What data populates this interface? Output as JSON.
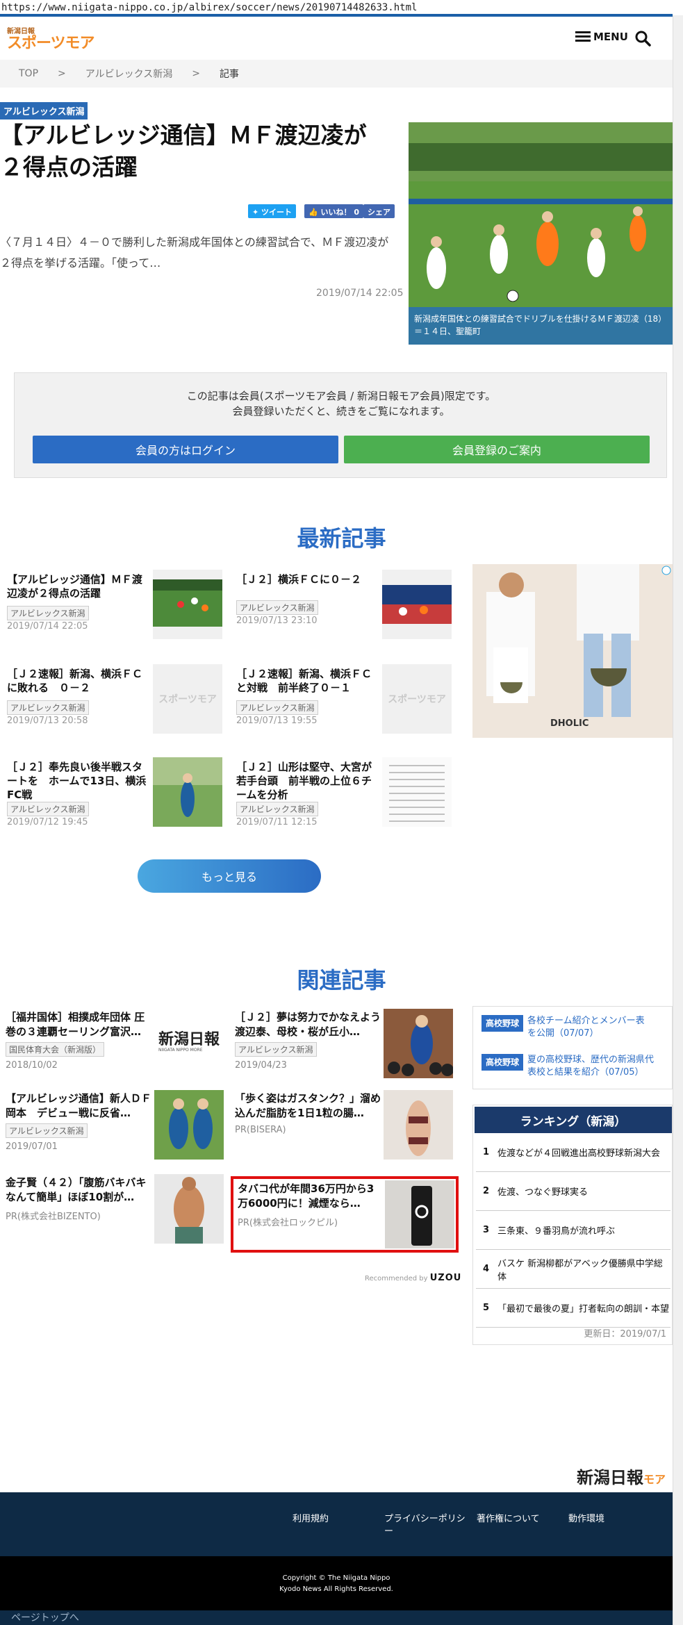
{
  "url": "https://www.niigata-nippo.co.jp/albirex/soccer/news/20190714482633.html",
  "header": {
    "logo_small": "新潟日報",
    "logo_main": "スポーツモア",
    "menu_label": "MENU"
  },
  "breadcrumb": [
    "TOP",
    ">",
    "アルビレックス新潟",
    ">",
    "記事"
  ],
  "article": {
    "category": "アルビレックス新潟",
    "title": "【アルビレッジ通信】ＭＦ渡辺凌が２得点の活躍",
    "share": {
      "tweet": "ツイート",
      "like": "いいね！ 0",
      "share": "シェア"
    },
    "lead": "〈７月１４日〉４－０で勝利した新潟成年国体との練習試合で、ＭＦ渡辺凌が２得点を挙げる活躍。「使って…",
    "date": "2019/07/14 22:05",
    "photo_caption": "新潟成年国体との練習試合でドリブルを仕掛けるＭＦ渡辺凌（18）＝１４日、聖籠町"
  },
  "member": {
    "line1": "この記事は会員(スポーツモア会員 / 新潟日報モア会員)限定です。",
    "line2": "会員登録いただくと、続きをご覧になれます。",
    "login": "会員の方はログイン",
    "register": "会員登録のご案内"
  },
  "latest": {
    "heading": "最新記事",
    "items": [
      {
        "title": "【アルビレッジ通信】ＭＦ渡辺凌が２得点の活躍",
        "tag": "アルビレックス新潟",
        "date": "2019/07/14 22:05"
      },
      {
        "title": "［Ｊ２］横浜ＦＣに０－２",
        "tag": "アルビレックス新潟",
        "date": "2019/07/13 23:10"
      },
      {
        "title": "［Ｊ２速報］新潟、横浜ＦＣに敗れる　０－２",
        "tag": "アルビレックス新潟",
        "date": "2019/07/13 20:58"
      },
      {
        "title": "［Ｊ２速報］新潟、横浜ＦＣと対戦　前半終了０－１",
        "tag": "アルビレックス新潟",
        "date": "2019/07/13 19:55"
      },
      {
        "title": "［Ｊ２］奉先良い後半戦スタートを　ホームで13日、横浜FC戦",
        "tag": "アルビレックス新潟",
        "date": "2019/07/12 19:45"
      },
      {
        "title": "［Ｊ２］山形は堅守、大宮が若手台頭　前半戦の上位６チームを分析",
        "tag": "アルビレックス新潟",
        "date": "2019/07/11 12:15"
      }
    ],
    "thumb_logo_text": "スポーツモア",
    "more": "もっと見る",
    "ad_brand": "DHOLIC"
  },
  "related": {
    "heading": "関連記事",
    "items": [
      {
        "title": "［福井国体］相撲成年団体 圧巻の３連覇セーリング富沢…",
        "src": "国民体育大会（新潟版）",
        "date": "2018/10/02"
      },
      {
        "title": "［Ｊ２］夢は努力でかなえよう渡辺泰、母校・桜が丘小…",
        "src": "アルビレックス新潟",
        "date": "2019/04/23"
      },
      {
        "title": "【アルビレッジ通信】新人ＤＦ岡本　デビュー戦に反省…",
        "src": "アルビレックス新潟",
        "date": "2019/07/01"
      },
      {
        "title": "「歩く姿はガスタンク？」溜め込んだ脂肪を1日1粒の腸…",
        "src": "PR(BISERA)",
        "date": ""
      },
      {
        "title": "金子賢（４２）「腹筋バキバキなんて簡単」ほぼ10割が…",
        "src": "PR(株式会社BIZENTO)",
        "date": ""
      },
      {
        "title": "タバコ代が年間36万円から3万6000円に！減煙なら…",
        "src": "PR(株式会社ロックピル)",
        "date": ""
      }
    ],
    "nippo_logo": "新潟日報",
    "nippo_logo_sub": "NIIGATA NIPPO MORE",
    "recommended": "Recommended by",
    "uzou": "UZOU"
  },
  "highschool": {
    "badge": "高校野球",
    "items": [
      "各校チーム紹介とメンバー表を公開（07/07）",
      "夏の高校野球、歴代の新潟県代表校と結果を紹介（07/05）"
    ]
  },
  "ranking": {
    "title": "ランキング（新潟）",
    "items": [
      {
        "n": "1",
        "t": "佐渡などが４回戦進出高校野球新潟大会"
      },
      {
        "n": "2",
        "t": "佐渡、つなぐ野球実る"
      },
      {
        "n": "3",
        "t": "三条東、９番羽鳥が流れ呼ぶ"
      },
      {
        "n": "4",
        "t": "バスケ 新潟柳都がアベック優勝県中学総体"
      },
      {
        "n": "5",
        "t": "「最初で最後の夏」打者転向の朗訓・本望"
      }
    ],
    "updated": "更新日：2019/07/1"
  },
  "footer": {
    "logo": "新潟日報",
    "logo_sub": "モア",
    "links": [
      "利用規約",
      "プライバシーポリシー",
      "著作権について",
      "動作環境"
    ],
    "copy1": "Copyright © The Niigata Nippo",
    "copy2": "Kyodo News All Rights Reserved.",
    "pagetop": "ページトップへ"
  },
  "colors": {
    "accent": "#2b6cc4",
    "register": "#4caf50",
    "footer": "#0e2a45",
    "highlight": "#e01010"
  }
}
